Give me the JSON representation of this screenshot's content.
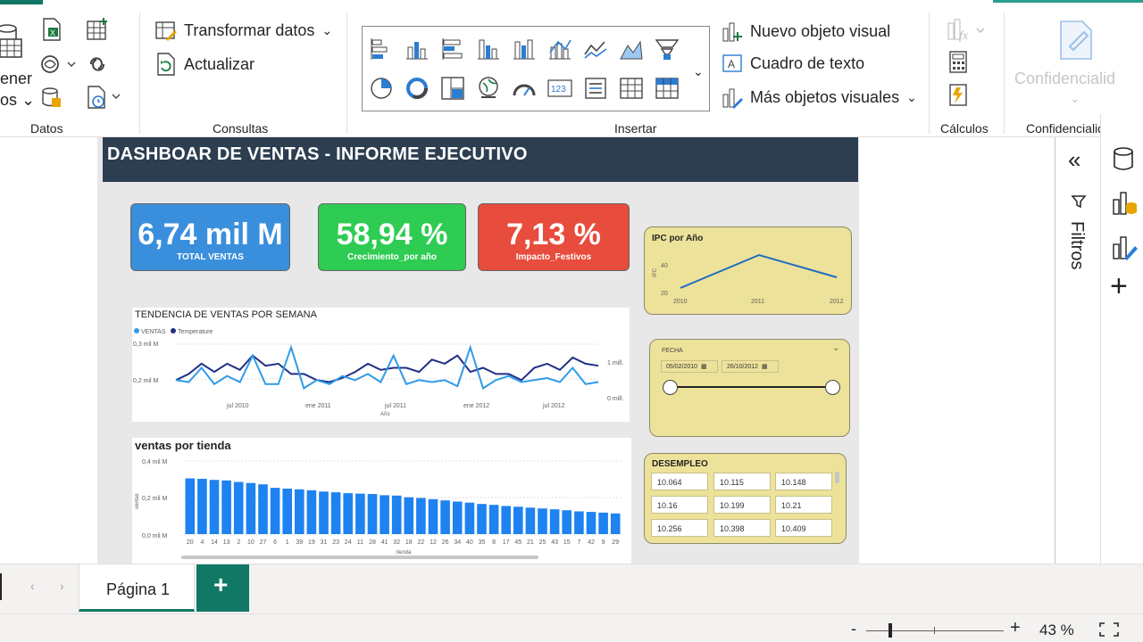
{
  "ribbon": {
    "datos": {
      "label": "Datos",
      "get_data_label_1": "ener",
      "get_data_label_2": "os"
    },
    "consultas": {
      "label": "Consultas",
      "transform_label": "Transformar datos",
      "refresh_label": "Actualizar"
    },
    "insertar": {
      "label": "Insertar",
      "new_visual_label": "Nuevo objeto visual",
      "textbox_label": "Cuadro de texto",
      "more_visuals_label": "Más objetos visuales"
    },
    "calculos": {
      "label": "Cálculos"
    },
    "confidencialidad": {
      "label": "Confidencialida",
      "button_label": "Confidencialid"
    }
  },
  "report": {
    "title": "DASHBOAR DE VENTAS - INFORME EJECUTIVO",
    "kpis": [
      {
        "value": "6,74 mil M",
        "label": "TOTAL VENTAS",
        "color": "#3a8fdc"
      },
      {
        "value": "58,94 %",
        "label": "Crecimiento_por año",
        "color": "#2ecc52"
      },
      {
        "value": "7,13 %",
        "label": "Impacto_Festivos",
        "color": "#e74c3c"
      }
    ],
    "ipc": {
      "title": "IPC por Año",
      "ylabel": "IPC",
      "ticks_y": [
        "40",
        "20"
      ],
      "ticks_x": [
        "2010",
        "2011",
        "2012"
      ]
    },
    "fecha": {
      "label": "FECHA",
      "start": "05/02/2010",
      "end": "26/10/2012"
    },
    "desempleo": {
      "title": "DESEMPLEO",
      "values": [
        "10.064",
        "10.115",
        "10.148",
        "10.16",
        "10.199",
        "10.21",
        "10.256",
        "10.398",
        "10.409"
      ]
    }
  },
  "chart_data": [
    {
      "type": "line",
      "title": "TENDENCIA DE VENTAS POR SEMANA",
      "xlabel": "Año",
      "legend": [
        "VENTAS",
        "Temperature"
      ],
      "y_ticks_left": [
        "0,3 mil M",
        "0,2 mil M"
      ],
      "y_ticks_right": [
        "1 mill.",
        "0 mill."
      ],
      "x_ticks": [
        "jul 2010",
        "ene 2011",
        "jul 2011",
        "ene 2012",
        "jul 2012"
      ],
      "series": [
        {
          "name": "VENTAS",
          "color": "#2f9be8",
          "values": [
            0.2,
            0.195,
            0.23,
            0.19,
            0.21,
            0.195,
            0.26,
            0.19,
            0.19,
            0.28,
            0.18,
            0.2,
            0.19,
            0.21,
            0.2,
            0.215,
            0.195,
            0.26,
            0.19,
            0.2,
            0.195,
            0.2,
            0.185,
            0.28,
            0.18,
            0.2,
            0.21,
            0.195,
            0.2,
            0.205,
            0.195,
            0.23,
            0.19,
            0.195
          ]
        },
        {
          "name": "Temperature",
          "color": "#1f2f85",
          "values": [
            0.2,
            0.215,
            0.24,
            0.22,
            0.24,
            0.225,
            0.26,
            0.235,
            0.24,
            0.215,
            0.215,
            0.2,
            0.195,
            0.205,
            0.22,
            0.24,
            0.225,
            0.23,
            0.23,
            0.22,
            0.25,
            0.24,
            0.26,
            0.22,
            0.23,
            0.215,
            0.215,
            0.2,
            0.23,
            0.24,
            0.225,
            0.255,
            0.24,
            0.235
          ]
        }
      ]
    },
    {
      "type": "bar",
      "title": "ventas por tienda",
      "xlabel": "tienda",
      "ylabel": "ventas",
      "y_ticks": [
        "0,4 mil M",
        "0,2 mil M",
        "0,0 mil M"
      ],
      "ylim": [
        0,
        0.4
      ],
      "color": "#1e82f0",
      "categories": [
        "20",
        "4",
        "14",
        "13",
        "2",
        "10",
        "27",
        "6",
        "1",
        "39",
        "19",
        "31",
        "23",
        "24",
        "11",
        "28",
        "41",
        "32",
        "18",
        "22",
        "12",
        "26",
        "34",
        "40",
        "35",
        "8",
        "17",
        "45",
        "21",
        "25",
        "43",
        "15",
        "7",
        "42",
        "9",
        "29"
      ],
      "values": [
        0.301,
        0.299,
        0.293,
        0.29,
        0.282,
        0.276,
        0.269,
        0.25,
        0.246,
        0.242,
        0.237,
        0.23,
        0.226,
        0.221,
        0.219,
        0.217,
        0.21,
        0.208,
        0.199,
        0.195,
        0.189,
        0.182,
        0.176,
        0.17,
        0.163,
        0.158,
        0.152,
        0.148,
        0.143,
        0.139,
        0.134,
        0.129,
        0.123,
        0.12,
        0.116,
        0.112
      ]
    }
  ],
  "pane": {
    "filters_label": "Filtros"
  },
  "tabs": {
    "page1": "Página 1",
    "add": "+"
  },
  "status": {
    "zoom": "43 %",
    "minus": "-",
    "plus": "+"
  }
}
